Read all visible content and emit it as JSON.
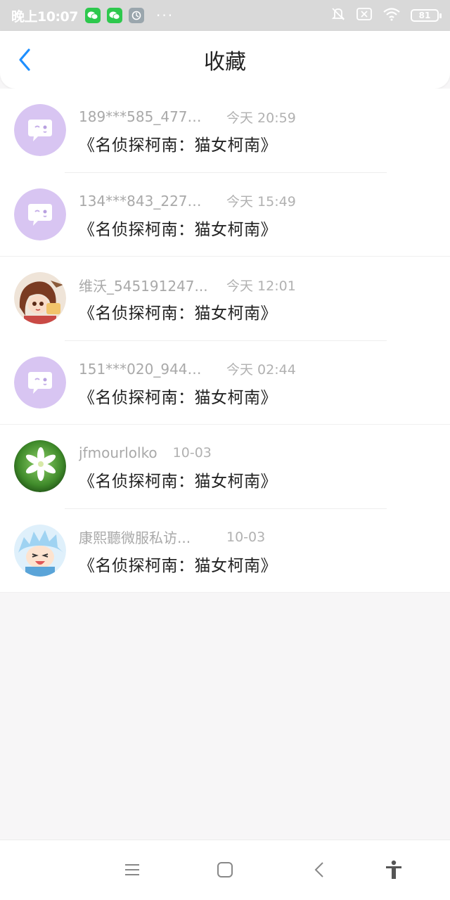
{
  "status_bar": {
    "time": "晚上10:07",
    "dots": "···",
    "battery": "81",
    "icons": [
      "wechat-icon",
      "wechat-icon",
      "app-icon",
      "mute-bell-icon",
      "no-sim-icon",
      "wifi-icon",
      "battery-icon"
    ]
  },
  "header": {
    "title": "收藏",
    "back_icon": "chevron-left-icon",
    "accent": "#1e8fff"
  },
  "list": {
    "items": [
      {
        "username": "189***585_4774...",
        "time": "今天 20:59",
        "title": "《名侦探柯南：猫女柯南》",
        "avatar": "chat-bubble-avatar"
      },
      {
        "username": "134***843_2272...",
        "time": "今天 15:49",
        "title": "《名侦探柯南：猫女柯南》",
        "avatar": "chat-bubble-avatar"
      },
      {
        "username": "维沃_545191247...",
        "time": "今天 12:01",
        "title": "《名侦探柯南：猫女柯南》",
        "avatar": "anime-girl-avatar"
      },
      {
        "username": "151***020_9443...",
        "time": "今天 02:44",
        "title": "《名侦探柯南：猫女柯南》",
        "avatar": "chat-bubble-avatar"
      },
      {
        "username": "jfmourlolko",
        "time": "10-03",
        "title": "《名侦探柯南：猫女柯南》",
        "avatar": "flower-avatar"
      },
      {
        "username": "康熙聽微服私访...",
        "time": "10-03",
        "title": "《名侦探柯南：猫女柯南》",
        "avatar": "anime-boy-avatar"
      }
    ]
  },
  "bottom_nav": {
    "icons": [
      "menu-icon",
      "home-square-icon",
      "back-triangle-icon",
      "accessibility-icon"
    ]
  }
}
